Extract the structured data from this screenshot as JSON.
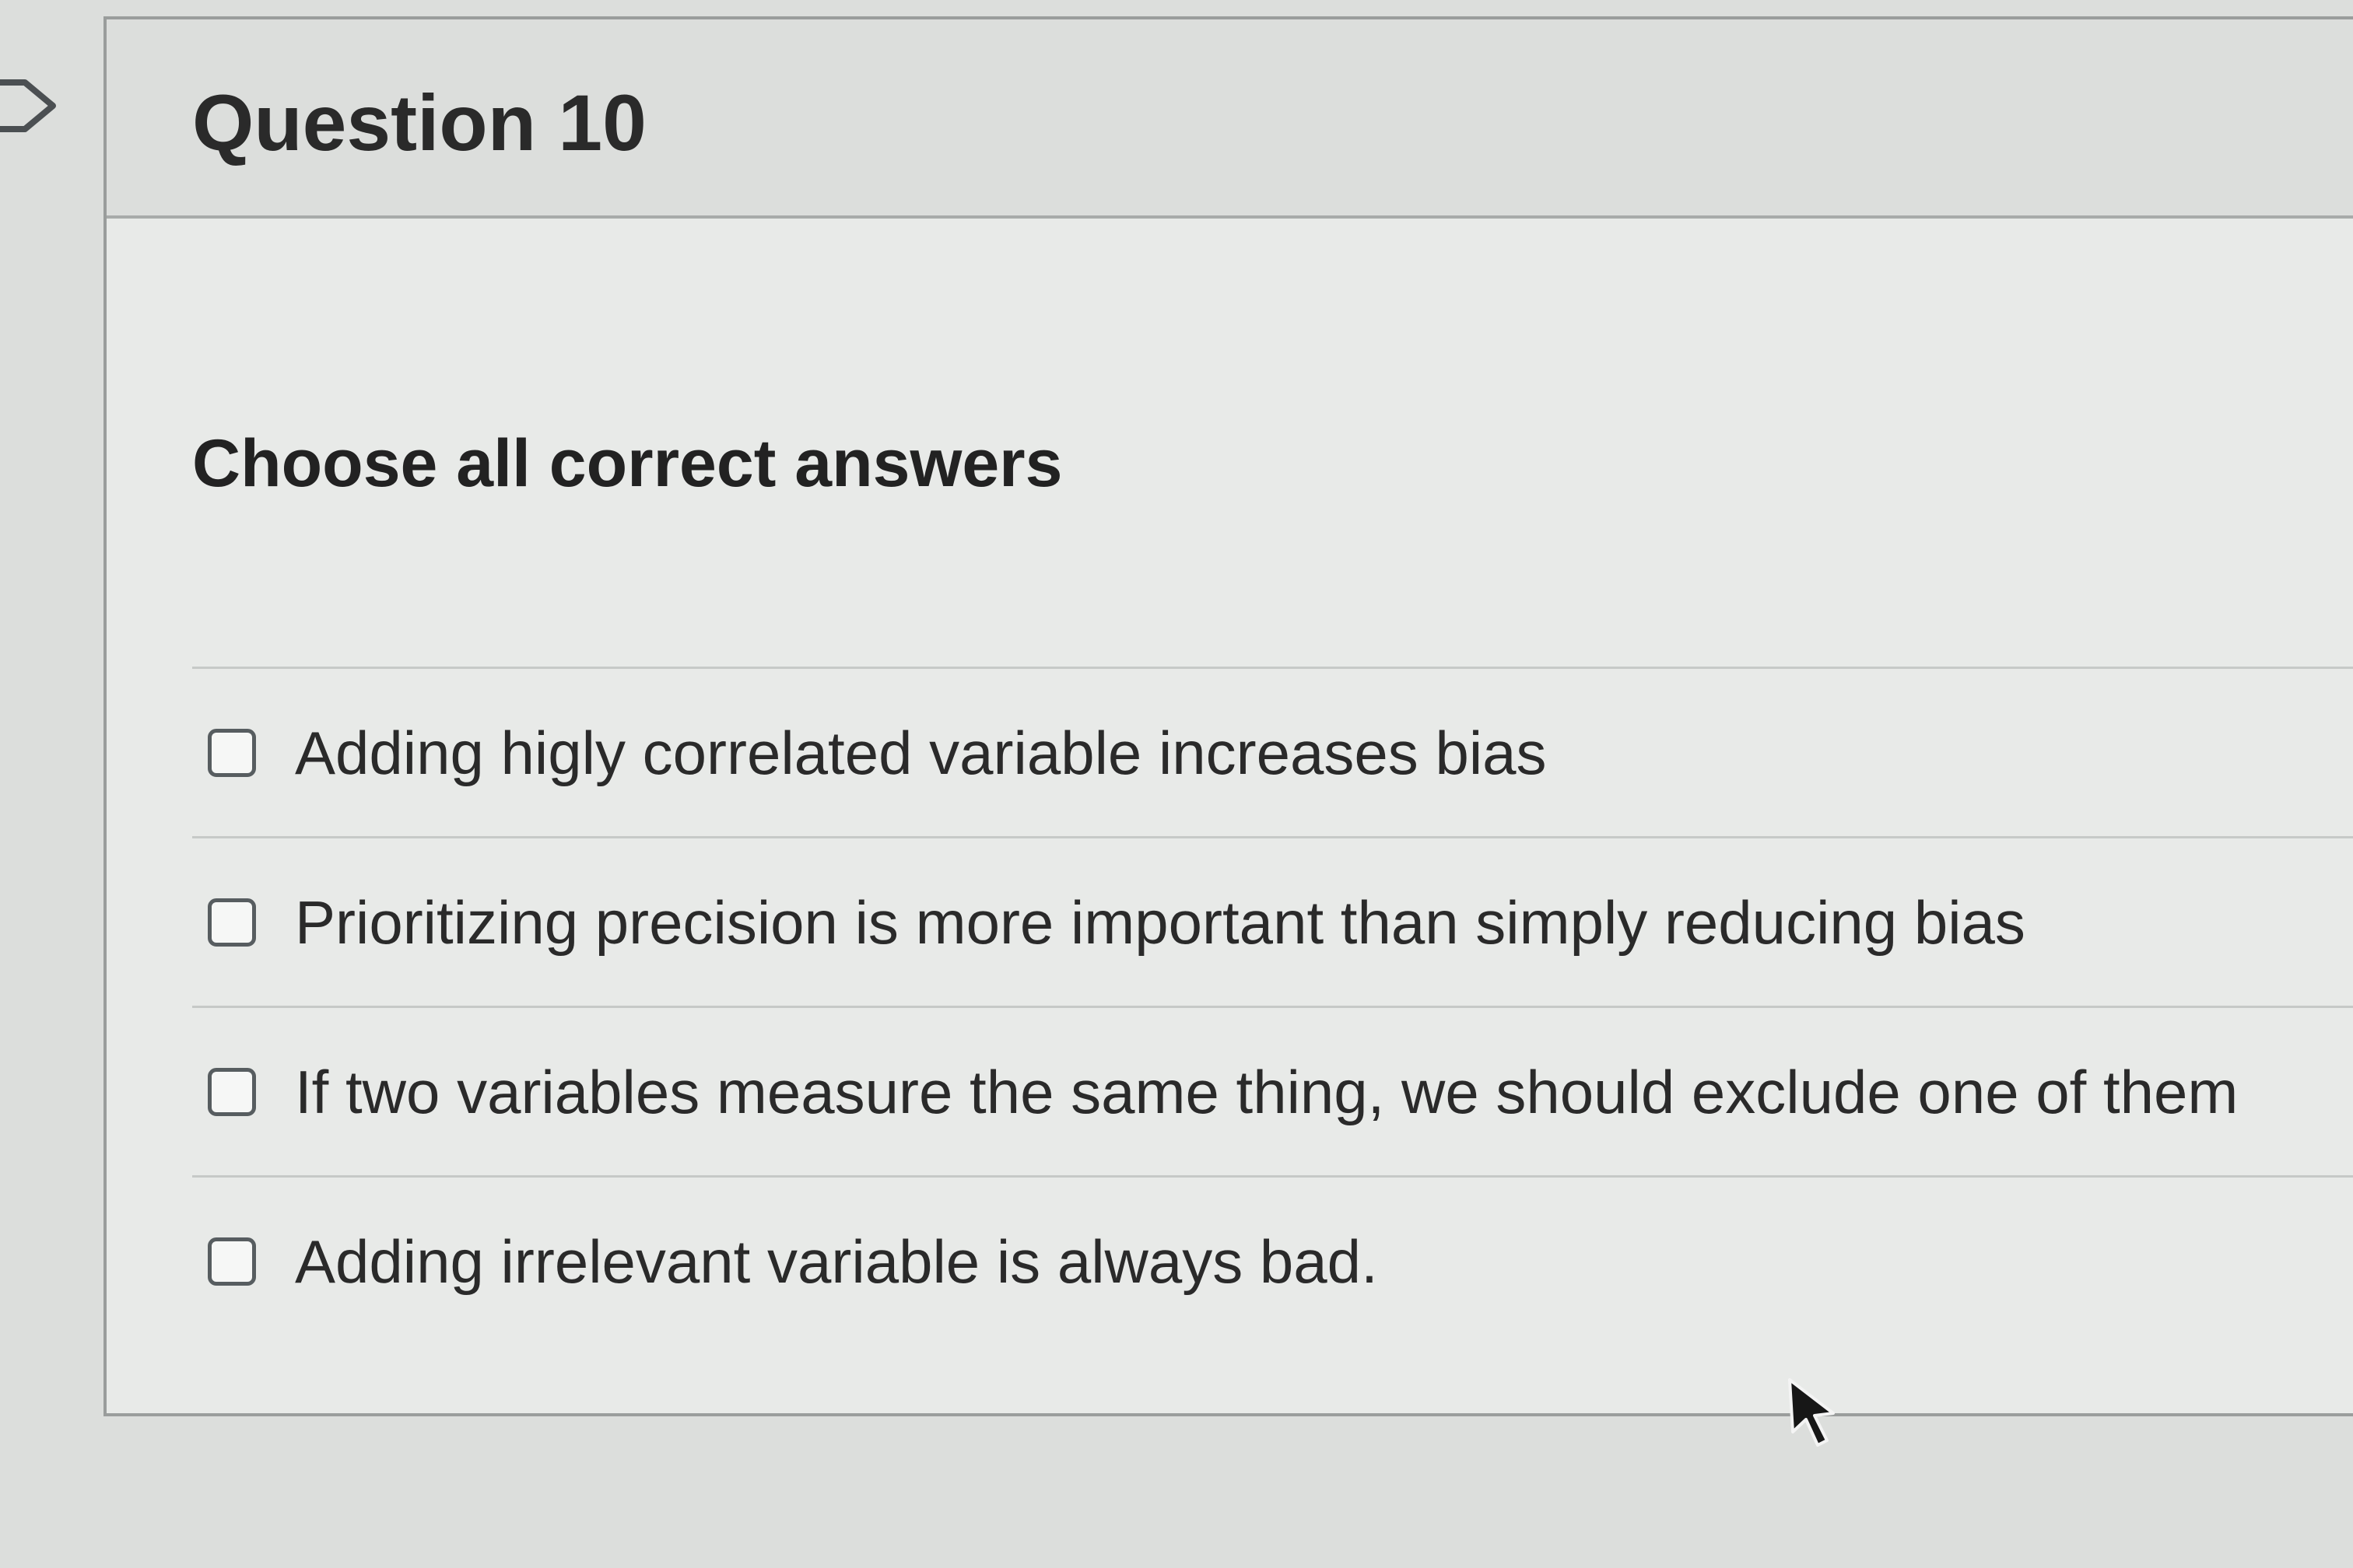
{
  "question": {
    "title": "Question 10",
    "prompt": "Choose all correct answers",
    "answers": [
      {
        "label": "Adding higly correlated variable increases bias",
        "checked": false
      },
      {
        "label": "Prioritizing precision is more important than simply reducing bias",
        "checked": false
      },
      {
        "label": "If two variables measure the same thing, we should exclude one of them",
        "checked": false
      },
      {
        "label": "Adding irrelevant variable is always bad.",
        "checked": false
      }
    ]
  },
  "icons": {
    "flag": "flag-outline-icon",
    "pointer": "mouse-pointer-icon"
  },
  "colors": {
    "page_background": "#dcdedc",
    "card_background": "#e8eae8",
    "border": "#9a9d9c",
    "text": "#2a2a2a"
  }
}
